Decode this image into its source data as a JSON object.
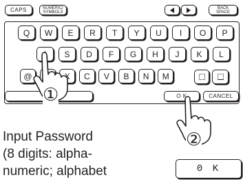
{
  "top_row": {
    "caps": "CAPS",
    "numeric_symbols": [
      "NUMERIC/",
      "SYMBOLS"
    ],
    "back_space": [
      "BACK",
      "SPACE"
    ]
  },
  "keyboard": {
    "row1": [
      "Q",
      "W",
      "E",
      "R",
      "T",
      "Y",
      "U",
      "I",
      "O",
      "P"
    ],
    "row2": [
      "A",
      "S",
      "D",
      "F",
      "G",
      "H",
      "J",
      "K",
      "L"
    ],
    "row3": [
      "@",
      "Z",
      "X",
      "C",
      "V",
      "B",
      "N",
      "M"
    ],
    "ok": "O K",
    "cancel": "CANCEL"
  },
  "steps": {
    "step1": "①",
    "step2": "②"
  },
  "caption": {
    "line1": "Input Password",
    "line2": "(8 digits: alpha-",
    "line3": "numeric; alphabet"
  },
  "ok_button": "0 K",
  "icons": {
    "left": "left-arrow-icon",
    "right": "right-arrow-icon",
    "hand": "pointing-hand-icon"
  }
}
